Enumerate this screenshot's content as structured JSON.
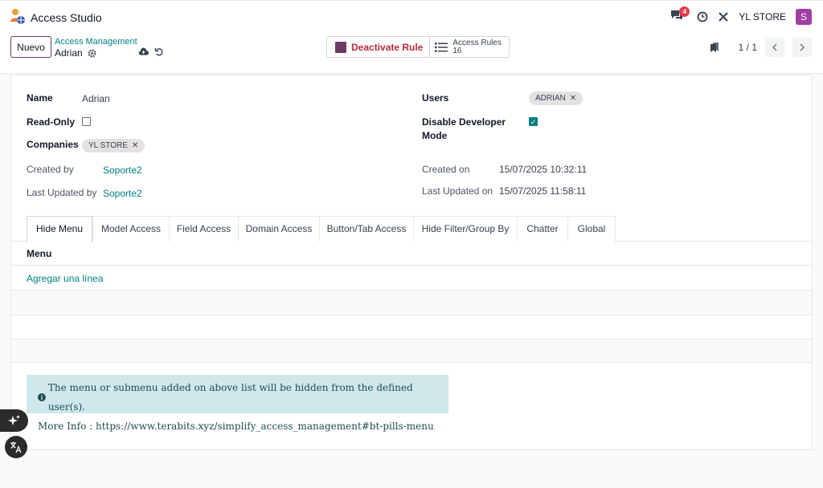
{
  "app": {
    "title": "Access Studio"
  },
  "navbar": {
    "chat_count": "4",
    "company": "YL STORE",
    "avatar_letter": "S"
  },
  "control": {
    "new_label": "Nuevo",
    "breadcrumb_parent": "Access Management",
    "breadcrumb_current": "Adrian",
    "deactivate_label": "Deactivate Rule",
    "rules_label": "Access Rules",
    "rules_count": "16",
    "pager": "1 / 1"
  },
  "form": {
    "name_label": "Name",
    "name_value": "Adrian",
    "readonly_label": "Read-Only",
    "companies_label": "Companies",
    "companies_tag": "YL STORE",
    "users_label": "Users",
    "users_tag": "ADRIAN",
    "disable_dev_label_1": "Disable Developer",
    "disable_dev_label_2": "Mode",
    "created_by_label": "Created by",
    "created_by_value": "Soporte2",
    "last_updated_by_label": "Last Updated by",
    "last_updated_by_value": "Soporte2",
    "created_on_label": "Created on",
    "created_on_value": "15/07/2025 10:32:11",
    "last_updated_on_label": "Last Updated on",
    "last_updated_on_value": "15/07/2025 11:58:11"
  },
  "tabs": [
    "Hide Menu",
    "Model Access",
    "Field Access",
    "Domain Access",
    "Button/Tab Access",
    "Hide Filter/Group By",
    "Chatter",
    "Global"
  ],
  "table": {
    "column_menu": "Menu",
    "add_line": "Agregar una línea"
  },
  "info": {
    "line1": "The menu or submenu added on above list will be hidden from the defined user(s).",
    "line2": "More Info : https://www.terabits.xyz/simplify_access_management#bt-pills-menu"
  },
  "colors": {
    "accent": "#017e84",
    "brand": "#6b3b63",
    "danger": "#b52b40",
    "avatar": "#a03fa2"
  }
}
